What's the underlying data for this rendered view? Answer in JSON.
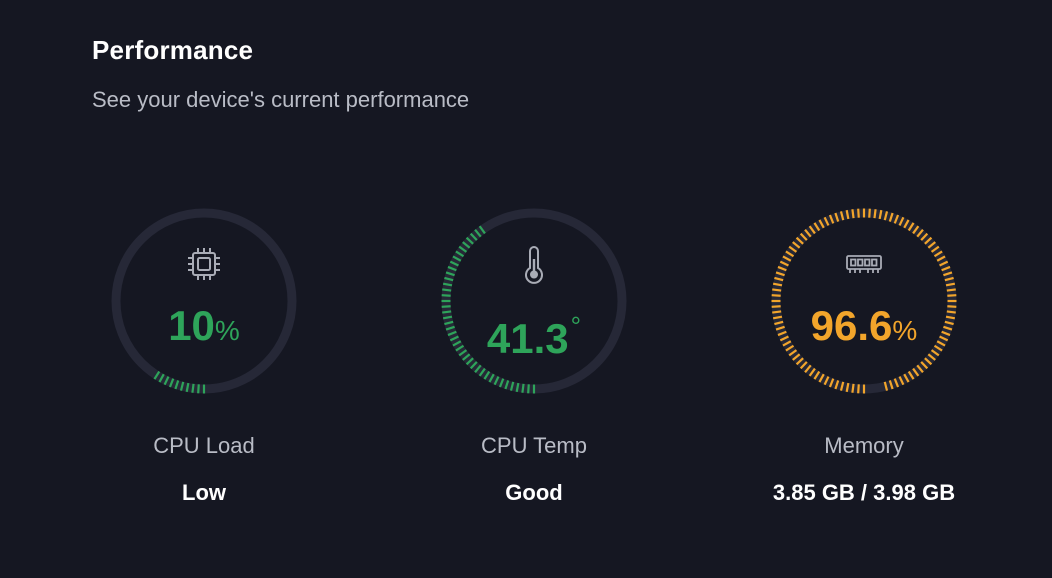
{
  "header": {
    "title": "Performance",
    "subtitle": "See your device's current performance"
  },
  "colors": {
    "background": "#151722",
    "track": "#262837",
    "good": "#2ea45a",
    "warn": "#f2a52b",
    "label": "#b9bcc6"
  },
  "gauges": {
    "cpu_load": {
      "icon": "cpu-chip-icon",
      "value": "10",
      "unit": "%",
      "fraction": 0.1,
      "color": "#2ea45a",
      "label": "CPU Load",
      "status": "Low"
    },
    "cpu_temp": {
      "icon": "thermometer-icon",
      "value": "41.3",
      "unit": "°",
      "fraction": 0.413,
      "color": "#2ea45a",
      "label": "CPU Temp",
      "status": "Good"
    },
    "memory": {
      "icon": "memory-module-icon",
      "value": "96.6",
      "unit": "%",
      "fraction": 0.966,
      "color": "#f2a52b",
      "label": "Memory",
      "status": "3.85 GB / 3.98 GB"
    }
  }
}
